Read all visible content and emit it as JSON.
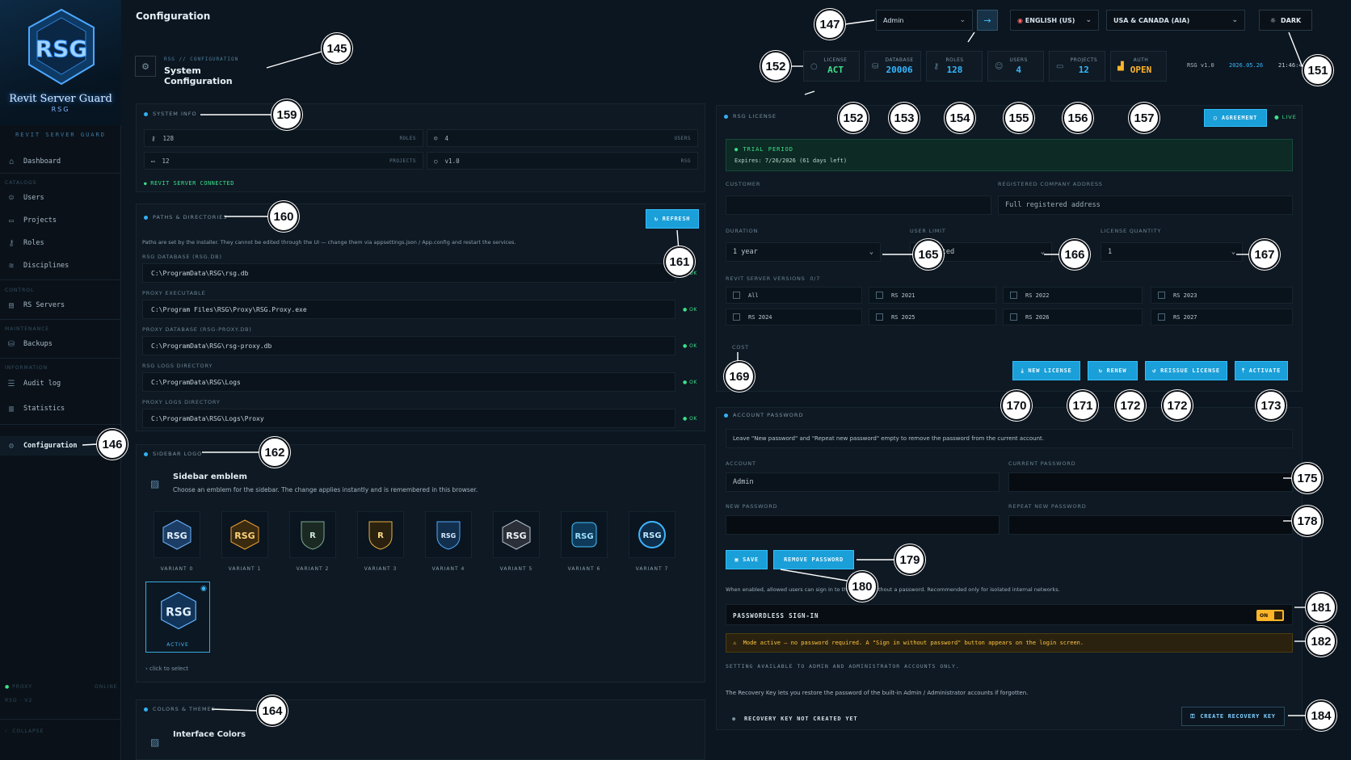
{
  "app": {
    "title": "Revit Server Guard",
    "subtitle": "RSG",
    "brand_label": "REVIT SERVER GUARD"
  },
  "sidebar": {
    "items": [
      {
        "label": "Dashboard",
        "icon": "home-icon"
      },
      {
        "section": "CATALOGS"
      },
      {
        "label": "Users",
        "icon": "users-icon"
      },
      {
        "label": "Projects",
        "icon": "folder-icon"
      },
      {
        "label": "Roles",
        "icon": "key-icon"
      },
      {
        "label": "Disciplines",
        "icon": "layers-icon"
      },
      {
        "section": "CONTROL"
      },
      {
        "label": "RS Servers",
        "icon": "server-icon"
      },
      {
        "section": "MAINTENANCE"
      },
      {
        "label": "Backups",
        "icon": "backup-icon"
      },
      {
        "section": "INFORMATION"
      },
      {
        "label": "Audit log",
        "icon": "log-icon"
      },
      {
        "label": "Statistics",
        "icon": "chart-icon"
      },
      {
        "label": "Configuration",
        "icon": "gear-icon",
        "active": true
      }
    ],
    "footer": {
      "proxy_label": "PROXY",
      "proxy_status": "ONLINE",
      "version": "RSG · V2",
      "collapse": "COLLAPSE"
    }
  },
  "topbar": {
    "title": "Configuration",
    "account_select": "Admin",
    "language_select": "ENGLISH (US)",
    "region_select": "USA & CANADA (AIA)",
    "theme_button": "DARK"
  },
  "header": {
    "breadcrumb": "RSG // CONFIGURATION",
    "title": "System Configuration"
  },
  "stats": [
    {
      "label": "LICENSE",
      "value": "ACT",
      "icon": "circle-icon",
      "color": "#3ee08a"
    },
    {
      "label": "DATABASE",
      "value": "20006",
      "icon": "database-icon",
      "color": "#34b7ff"
    },
    {
      "label": "ROLES",
      "value": "128",
      "icon": "key-icon",
      "color": "#34b7ff"
    },
    {
      "label": "USERS",
      "value": "4",
      "icon": "users-icon",
      "color": "#34b7ff"
    },
    {
      "label": "PROJECTS",
      "value": "12",
      "icon": "folder-icon",
      "color": "#34b7ff"
    },
    {
      "label": "AUTH",
      "value": "OPEN",
      "icon": "signal-icon",
      "color": "#ffb52a"
    }
  ],
  "meta": {
    "version": "RSG v1.0",
    "date": "2026.05.26",
    "time": "21:46:4"
  },
  "system_info": {
    "header": "SYSTEM INFO",
    "cells": [
      {
        "value": "128",
        "label": "ROLES"
      },
      {
        "value": "4",
        "label": "USERS"
      },
      {
        "value": "12",
        "label": "PROJECTS"
      },
      {
        "value": "v1.0",
        "label": "RSG"
      }
    ],
    "connected": "REVIT SERVER CONNECTED"
  },
  "paths": {
    "header": "PATHS & DIRECTORIES",
    "refresh": "REFRESH",
    "note": "Paths are set by the installer. They cannot be edited through the UI — change them via appsettings.json / App.config and restart the services.",
    "items": [
      {
        "label": "RSG DATABASE (RSG.DB)",
        "value": "C:\\ProgramData\\RSG\\rsg.db",
        "status": "OK"
      },
      {
        "label": "PROXY EXECUTABLE",
        "value": "C:\\Program Files\\RSG\\Proxy\\RSG.Proxy.exe",
        "status": "OK"
      },
      {
        "label": "PROXY DATABASE (RSG-PROXY.DB)",
        "value": "C:\\ProgramData\\RSG\\rsg-proxy.db",
        "status": "OK"
      },
      {
        "label": "RSG LOGS DIRECTORY",
        "value": "C:\\ProgramData\\RSG\\Logs",
        "status": "OK"
      },
      {
        "label": "PROXY LOGS DIRECTORY",
        "value": "C:\\ProgramData\\RSG\\Logs\\Proxy",
        "status": "OK"
      }
    ]
  },
  "sidebar_logo": {
    "header": "SIDEBAR LOGO",
    "title": "Sidebar emblem",
    "desc": "Choose an emblem for the sidebar. The change applies instantly and is remembered in this browser.",
    "variants": [
      "VARIANT 0",
      "VARIANT 1",
      "VARIANT 2",
      "VARIANT 3",
      "VARIANT 4",
      "VARIANT 5",
      "VARIANT 6",
      "VARIANT 7"
    ],
    "active_label": "ACTIVE",
    "hint": "› click to select"
  },
  "colors": {
    "header": "COLORS & THEMES",
    "title": "Interface Colors"
  },
  "license": {
    "header": "RSG LICENSE",
    "agreement": "AGREEMENT",
    "live": "LIVE",
    "trial_title": "TRIAL PERIOD",
    "trial_expires": "Expires: 7/26/2026 (61 days left)",
    "customer_label": "CUSTOMER",
    "customer_value": "",
    "address_label": "REGISTERED COMPANY ADDRESS",
    "address_placeholder": "Full registered address",
    "duration_label": "DURATION",
    "duration_value": "1 year",
    "user_limit_label": "USER LIMIT",
    "user_limit_value": "Unlimited",
    "quantity_label": "LICENSE QUANTITY",
    "quantity_value": "1",
    "versions_label": "REVIT SERVER VERSIONS",
    "versions_count": "0/7",
    "versions": [
      "All",
      "RS 2021",
      "RS 2022",
      "RS 2023",
      "RS 2024",
      "RS 2025",
      "RS 2026",
      "RS 2027"
    ],
    "cost_label": "COST",
    "buttons": {
      "new": "NEW LICENSE",
      "renew": "RENEW",
      "reissue": "REISSUE LICENSE",
      "activate": "ACTIVATE"
    }
  },
  "account": {
    "header": "ACCOUNT PASSWORD",
    "note": "Leave \"New password\" and \"Repeat new password\" empty to remove the password from the current account.",
    "account_label": "ACCOUNT",
    "account_value": "Admin",
    "current_label": "CURRENT PASSWORD",
    "new_label": "NEW PASSWORD",
    "repeat_label": "REPEAT NEW PASSWORD",
    "save": "SAVE",
    "remove": "REMOVE PASSWORD",
    "pwless_note": "When enabled, allowed users can sign in to the system without a password. Recommended only for isolated internal networks.",
    "pwless_label": "PASSWORDLESS SIGN-IN",
    "toggle": "ON",
    "warning": "Mode active — no password required. A \"Sign in without password\" button appears on the login screen.",
    "admin_only": "SETTING AVAILABLE TO ADMIN AND ADMINISTRATOR ACCOUNTS ONLY.",
    "recovery_note": "The Recovery Key lets you restore the password of the built-in Admin / Administrator accounts if forgotten.",
    "recovery_status": "RECOVERY KEY NOT CREATED YET",
    "recovery_button": "CREATE RECOVERY KEY"
  },
  "callouts": [
    "145",
    "146",
    "147",
    "151",
    "152",
    "152",
    "153",
    "154",
    "155",
    "156",
    "157",
    "159",
    "160",
    "161",
    "162",
    "164",
    "165",
    "166",
    "167",
    "169",
    "170",
    "171",
    "172",
    "172",
    "173",
    "175",
    "178",
    "179",
    "180",
    "181",
    "182",
    "184"
  ],
  "colors_palette": {
    "accent": "#1a9fd8",
    "bg": "#0c1620",
    "ok": "#3ee08a",
    "warn": "#ffb52a"
  }
}
